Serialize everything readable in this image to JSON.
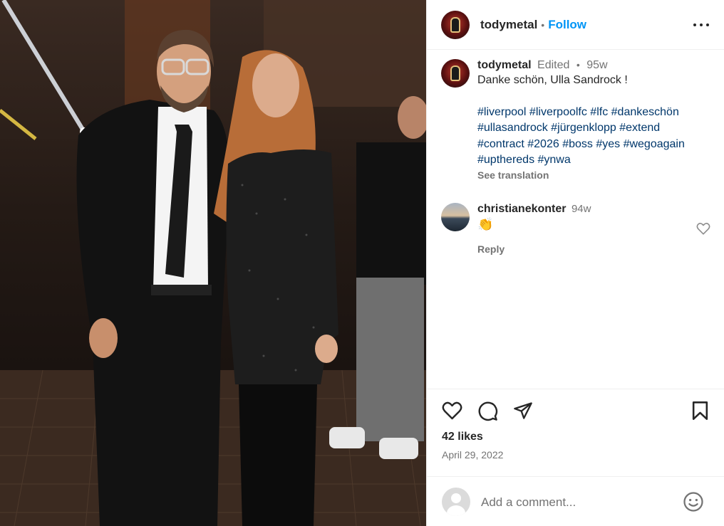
{
  "post": {
    "author": "todymetal",
    "follow_label": "Follow",
    "separator": "•",
    "caption": {
      "username": "todymetal",
      "edited": "Edited",
      "separator": "•",
      "time": "95w",
      "text": "Danke schön, Ulla Sandrock !",
      "hashtags_line1": "#liverpool #liverpoolfc #lfc #dankeschön",
      "hashtags_line2": "#ullasandrock #jürgenklopp #extend",
      "hashtags_line3": "#contract #2026 #boss #yes #wegoagain",
      "hashtags_line4": "#upthereds #ynwa",
      "see_translation": "See translation"
    },
    "comments": [
      {
        "username": "christianekonter",
        "time": "94w",
        "text": "👏",
        "reply_label": "Reply"
      }
    ],
    "likes": "42 likes",
    "date": "April 29, 2022",
    "comment_placeholder": "Add a comment..."
  },
  "icons": {
    "more": "more-options-icon",
    "like": "heart-icon",
    "comment": "comment-icon",
    "share": "share-icon",
    "save": "bookmark-icon",
    "emoji": "emoji-icon"
  },
  "colors": {
    "link": "#0095f6",
    "hashtag": "#00376b",
    "muted": "#737373"
  }
}
